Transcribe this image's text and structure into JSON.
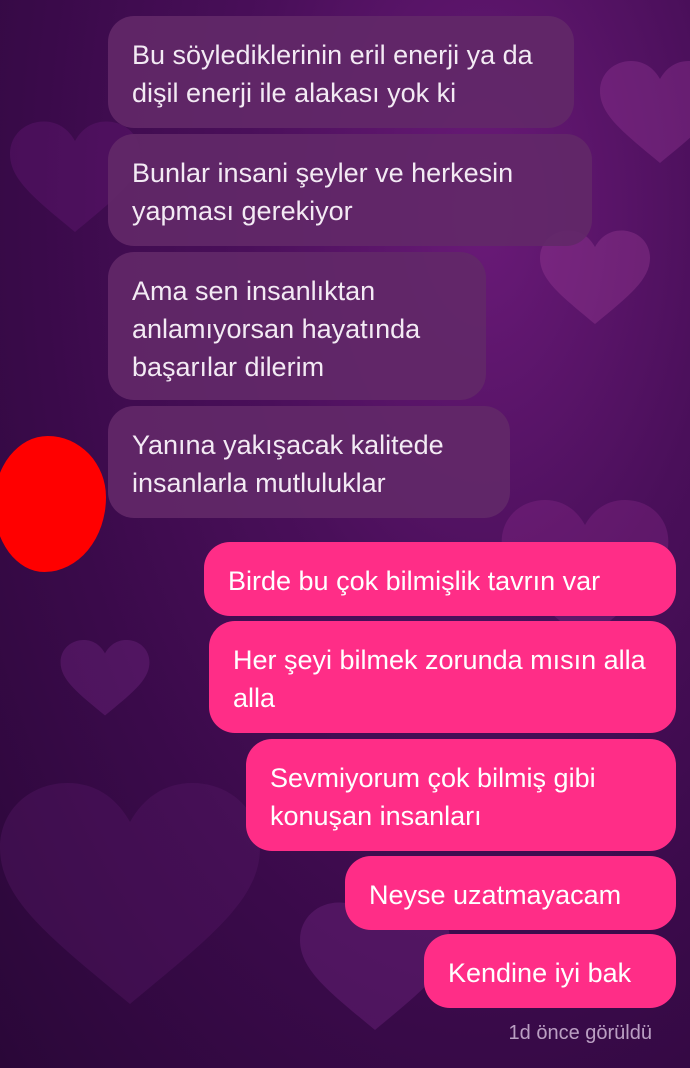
{
  "theme": {
    "incoming_color": "#622868",
    "outgoing_color": "#ff2d87",
    "background_color": "#3a0a4a",
    "redaction_color": "#ff0000"
  },
  "messages": {
    "incoming": [
      {
        "text": "Bu söylediklerinin eril enerji ya da dişil enerji ile alakası yok ki"
      },
      {
        "text": "Bunlar insani şeyler ve herkesin yapması gerekiyor"
      },
      {
        "text": "Ama sen insanlıktan anlamıyorsan hayatında başarılar dilerim"
      },
      {
        "text": "Yanına yakışacak kalitede insanlarla mutluluklar"
      }
    ],
    "outgoing": [
      {
        "text": "Birde bu çok bilmişlik tavrın var"
      },
      {
        "text": "Her şeyi bilmek zorunda mısın alla alla"
      },
      {
        "text": "Sevmiyorum çok bilmiş gibi konuşan insanları"
      },
      {
        "text": "Neyse uzatmayacam"
      },
      {
        "text": "Kendine iyi bak"
      }
    ]
  },
  "status": {
    "seen_text": "1d önce görüldü"
  }
}
